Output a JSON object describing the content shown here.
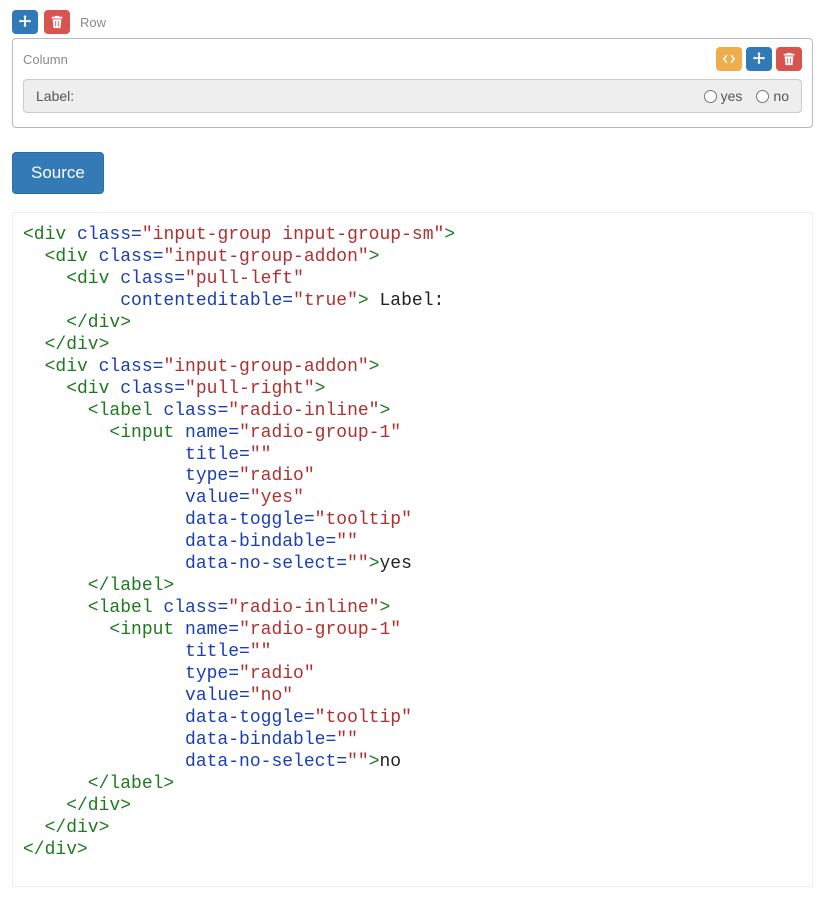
{
  "row": {
    "label": "Row"
  },
  "column": {
    "label": "Column"
  },
  "form": {
    "label_text": "Label:",
    "options": {
      "yes": "yes",
      "no": "no"
    }
  },
  "source_button": "Source",
  "code": {
    "l01a": "<div",
    "l01b": " class",
    "l01c": "=",
    "l01d": "\"input-group input-group-sm\"",
    "l01e": ">",
    "l02a": "  <div",
    "l02b": " class",
    "l02c": "=",
    "l02d": "\"input-group-addon\"",
    "l02e": ">",
    "l03a": "    <div",
    "l03b": " class",
    "l03c": "=",
    "l03d": "\"pull-left\"",
    "l04a": "         contenteditable",
    "l04b": "=",
    "l04c": "\"true\"",
    "l04d": ">",
    "l04e": " Label:",
    "l05": "    </div>",
    "l06": "  </div>",
    "l07a": "  <div",
    "l07b": " class",
    "l07c": "=",
    "l07d": "\"input-group-addon\"",
    "l07e": ">",
    "l08a": "    <div",
    "l08b": " class",
    "l08c": "=",
    "l08d": "\"pull-right\"",
    "l08e": ">",
    "l09a": "      <label",
    "l09b": " class",
    "l09c": "=",
    "l09d": "\"radio-inline\"",
    "l09e": ">",
    "l10a": "        <input",
    "l10b": " name",
    "l10c": "=",
    "l10d": "\"radio-group-1\"",
    "l11a": "               title",
    "l11b": "=",
    "l11c": "\"\"",
    "l12a": "               type",
    "l12b": "=",
    "l12c": "\"radio\"",
    "l13a": "               value",
    "l13b": "=",
    "l13c": "\"yes\"",
    "l14a": "               data-toggle",
    "l14b": "=",
    "l14c": "\"tooltip\"",
    "l15a": "               data-bindable",
    "l15b": "=",
    "l15c": "\"\"",
    "l16a": "               data-no-select",
    "l16b": "=",
    "l16c": "\"\"",
    "l16d": ">",
    "l16e": "yes",
    "l17": "      </label>",
    "l18a": "      <label",
    "l18b": " class",
    "l18c": "=",
    "l18d": "\"radio-inline\"",
    "l18e": ">",
    "l19a": "        <input",
    "l19b": " name",
    "l19c": "=",
    "l19d": "\"radio-group-1\"",
    "l20a": "               title",
    "l20b": "=",
    "l20c": "\"\"",
    "l21a": "               type",
    "l21b": "=",
    "l21c": "\"radio\"",
    "l22a": "               value",
    "l22b": "=",
    "l22c": "\"no\"",
    "l23a": "               data-toggle",
    "l23b": "=",
    "l23c": "\"tooltip\"",
    "l24a": "               data-bindable",
    "l24b": "=",
    "l24c": "\"\"",
    "l25a": "               data-no-select",
    "l25b": "=",
    "l25c": "\"\"",
    "l25d": ">",
    "l25e": "no",
    "l26": "      </label>",
    "l27": "    </div>",
    "l28": "  </div>",
    "l29": "</div>"
  }
}
